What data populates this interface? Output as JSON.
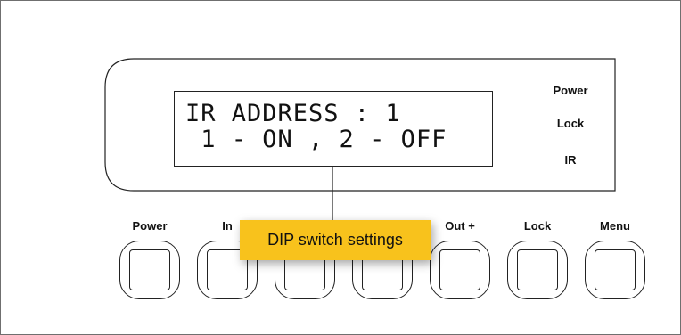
{
  "lcd": {
    "line1": "IR ADDRESS : 1",
    "line2": " 1 - ON , 2 - OFF"
  },
  "status_indicators": {
    "power": "Power",
    "lock": "Lock",
    "ir": "IR"
  },
  "buttons": [
    {
      "label": "Power"
    },
    {
      "label": "In"
    },
    {
      "label": ""
    },
    {
      "label": ""
    },
    {
      "label": "Out +"
    },
    {
      "label": "Lock"
    },
    {
      "label": "Menu"
    }
  ],
  "callout": {
    "text": "DIP switch settings",
    "color": "#f8c21c"
  }
}
